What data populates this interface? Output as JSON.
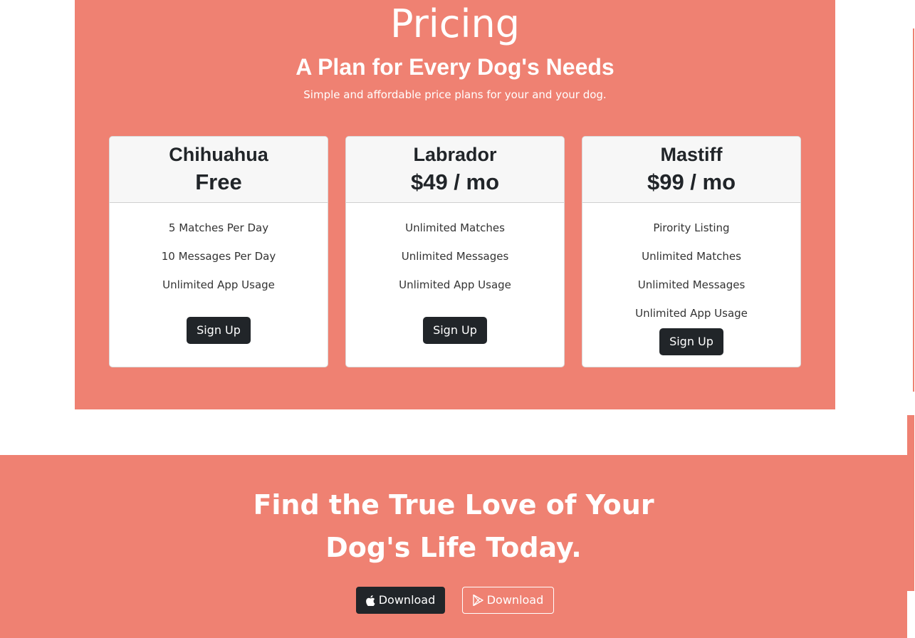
{
  "pricing": {
    "title": "Pricing",
    "subtitle": "A Plan for Every Dog's Needs",
    "tagline": "Simple and affordable price plans for your and your dog.",
    "plans": [
      {
        "name": "Chihuahua",
        "price": "Free",
        "features": [
          "5 Matches Per Day",
          "10 Messages Per Day",
          "Unlimited App Usage"
        ],
        "button_label": "Sign Up"
      },
      {
        "name": "Labrador",
        "price": "$49 / mo",
        "features": [
          "Unlimited Matches",
          "Unlimited Messages",
          "Unlimited App Usage"
        ],
        "button_label": "Sign Up"
      },
      {
        "name": "Mastiff",
        "price": "$99 / mo",
        "features": [
          "Pirority Listing",
          "Unlimited Matches",
          "Unlimited Messages",
          "Unlimited App Usage"
        ],
        "button_label": "Sign Up"
      }
    ]
  },
  "cta": {
    "title_line1": "Find the True Love of Your",
    "title_line2": "Dog's Life Today.",
    "apple_button_label": "Download",
    "play_button_label": "Download",
    "apple_icon": "apple-icon",
    "play_icon": "google-play-icon"
  },
  "colors": {
    "accent": "#ef8172",
    "dark": "#212529",
    "white": "#ffffff"
  }
}
